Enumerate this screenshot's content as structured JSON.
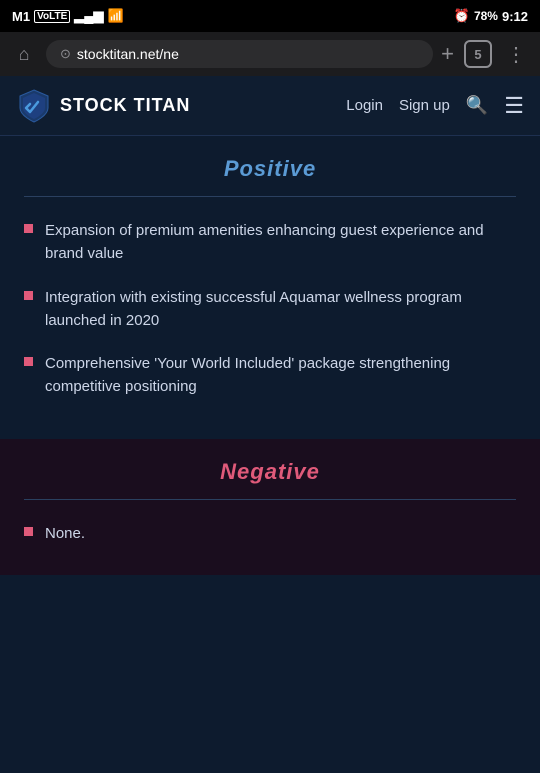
{
  "statusBar": {
    "carrier": "M1",
    "carrierType": "VoLTE",
    "time": "9:12",
    "battery": "78",
    "alarmIcon": "⏰"
  },
  "browser": {
    "homeIcon": "⌂",
    "url": "stocktitan.net/ne",
    "addTabIcon": "+",
    "tabCount": "5",
    "moreIcon": "⋮"
  },
  "siteNav": {
    "logoText": "STOCK TITAN",
    "loginLabel": "Login",
    "signUpLabel": "Sign up",
    "searchIcon": "🔍",
    "menuIcon": "☰"
  },
  "sections": {
    "positive": {
      "title": "Positive",
      "bullets": [
        "Expansion of premium amenities enhancing guest experience and brand value",
        "Integration with existing successful Aquamar wellness program launched in 2020",
        "Comprehensive 'Your World Included' package strengthening competitive positioning"
      ]
    },
    "negative": {
      "title": "Negative",
      "bullets": [
        "None."
      ]
    }
  }
}
